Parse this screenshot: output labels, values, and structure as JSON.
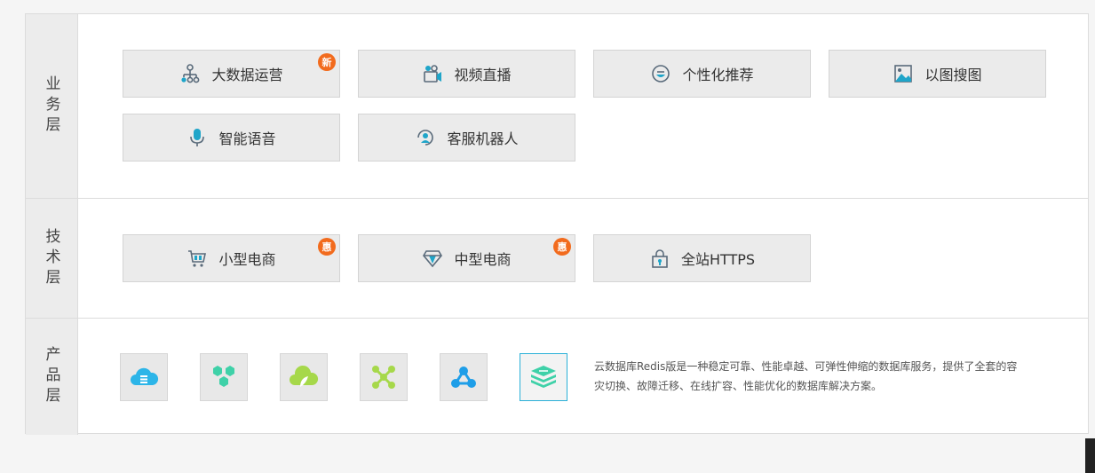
{
  "layers": {
    "business": {
      "label": "业务层",
      "items": [
        {
          "label": "大数据运营",
          "icon": "hierarchy-icon",
          "badge": "新"
        },
        {
          "label": "视频直播",
          "icon": "video-camera-icon",
          "badge": ""
        },
        {
          "label": "个性化推荐",
          "icon": "recommend-icon",
          "badge": ""
        },
        {
          "label": "以图搜图",
          "icon": "image-icon",
          "badge": ""
        },
        {
          "label": "智能语音",
          "icon": "microphone-icon",
          "badge": ""
        },
        {
          "label": "客服机器人",
          "icon": "service-robot-icon",
          "badge": ""
        }
      ]
    },
    "technology": {
      "label": "技术层",
      "items": [
        {
          "label": "小型电商",
          "icon": "shopping-cart-icon",
          "badge": "惠"
        },
        {
          "label": "中型电商",
          "icon": "diamond-icon",
          "badge": "惠"
        },
        {
          "label": "全站HTTPS",
          "icon": "lock-icon",
          "badge": ""
        }
      ]
    },
    "product": {
      "label": "产品层",
      "tiles": [
        {
          "icon": "cloud-database-icon",
          "active": false
        },
        {
          "icon": "hexagon-cluster-icon",
          "active": false
        },
        {
          "icon": "cloud-leaf-icon",
          "active": false
        },
        {
          "icon": "network-nodes-icon",
          "active": false
        },
        {
          "icon": "triangle-nodes-icon",
          "active": false
        },
        {
          "icon": "database-layers-icon",
          "active": true
        }
      ],
      "description": "云数据库Redis版是一种稳定可靠、性能卓越、可弹性伸缩的数据库服务，提供了全套的容灾切换、故障迁移、在线扩容、性能优化的数据库解决方案。"
    }
  },
  "colors": {
    "accent": "#2ab0d8",
    "badge": "#f26b1d",
    "icon_teal": "#1fa5c9",
    "icon_green": "#7ed321",
    "icon_mint": "#3fd1a8"
  }
}
